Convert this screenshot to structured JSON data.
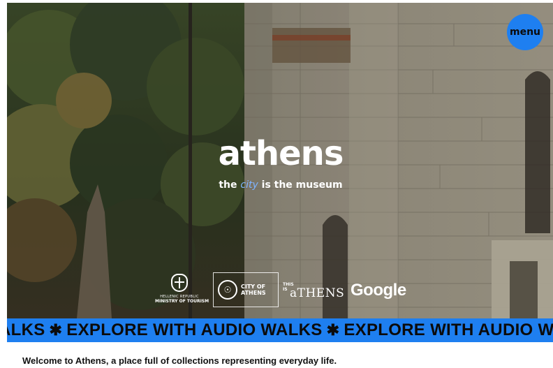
{
  "colors": {
    "accent": "#1e7ff0",
    "accent_light": "#7fb3ff",
    "text_dark": "#111111",
    "text_light": "#ffffff"
  },
  "header": {
    "menu_label": "menu"
  },
  "hero": {
    "logo": "athens",
    "tagline": {
      "before": "the",
      "accent": "city",
      "after": "is the museum"
    }
  },
  "partners": {
    "ministry": {
      "line1": "HELLENIC REPUBLIC",
      "line2": "MINISTRY OF TOURISM"
    },
    "city": {
      "label": "CITY OF ATHENS"
    },
    "this_is_athens": {
      "small": "THIS IS",
      "big": "aTHENS"
    },
    "google": {
      "label": "Google"
    }
  },
  "marquee": {
    "items": [
      "ALKS",
      "EXPLORE WITH AUDIO WALKS",
      "EXPLORE WITH AUDIO W"
    ],
    "separator": "✱"
  },
  "intro": {
    "text": "Welcome to Athens, a place full of collections representing everyday life."
  }
}
